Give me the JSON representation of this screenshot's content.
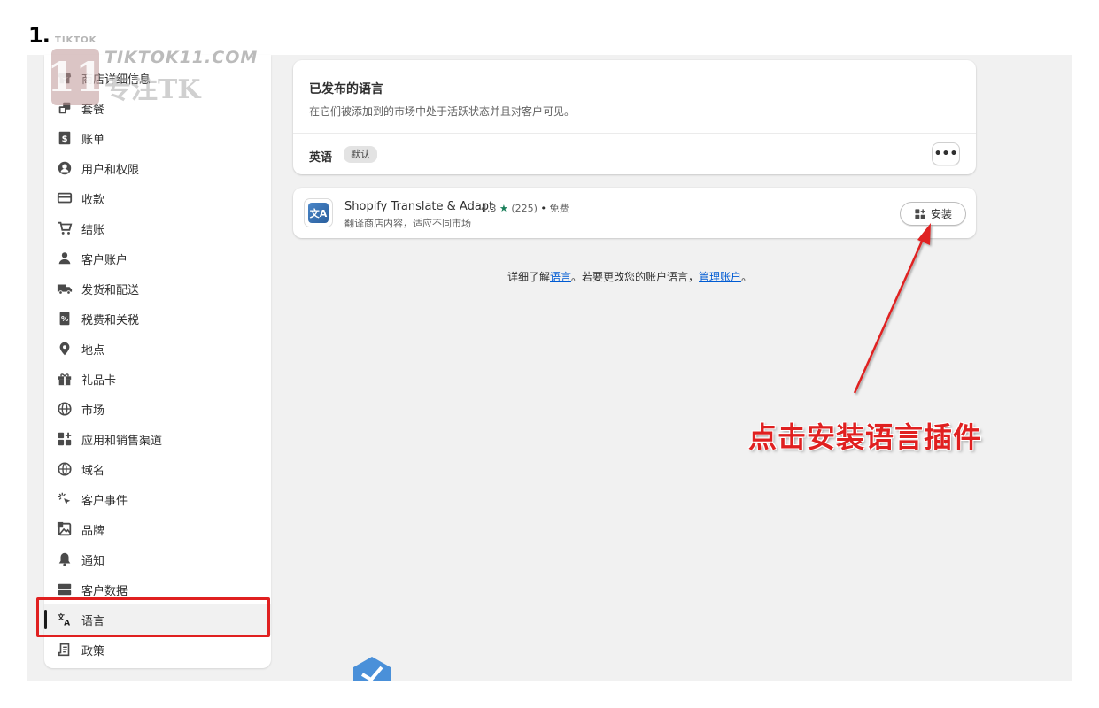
{
  "step_label": "1.",
  "watermark": {
    "small": "TIKTOK",
    "logo": "11",
    "line1": "TIKTOK11.COM",
    "line2": "专注TK"
  },
  "sidebar": {
    "items": [
      {
        "label": "商店详细信息",
        "icon": "store-icon"
      },
      {
        "label": "套餐",
        "icon": "plan-icon"
      },
      {
        "label": "账单",
        "icon": "billing-icon"
      },
      {
        "label": "用户和权限",
        "icon": "user-circle-icon"
      },
      {
        "label": "收款",
        "icon": "payment-card-icon"
      },
      {
        "label": "结账",
        "icon": "cart-icon"
      },
      {
        "label": "客户账户",
        "icon": "person-icon"
      },
      {
        "label": "发货和配送",
        "icon": "truck-icon"
      },
      {
        "label": "税费和关税",
        "icon": "tax-receipt-icon"
      },
      {
        "label": "地点",
        "icon": "location-pin-icon"
      },
      {
        "label": "礼品卡",
        "icon": "gift-icon"
      },
      {
        "label": "市场",
        "icon": "globe-icon"
      },
      {
        "label": "应用和销售渠道",
        "icon": "apps-icon"
      },
      {
        "label": "域名",
        "icon": "domain-globe-icon"
      },
      {
        "label": "客户事件",
        "icon": "cursor-click-icon"
      },
      {
        "label": "品牌",
        "icon": "brand-image-icon"
      },
      {
        "label": "通知",
        "icon": "bell-icon"
      },
      {
        "label": "客户数据",
        "icon": "data-icon"
      },
      {
        "label": "语言",
        "icon": "translate-icon"
      },
      {
        "label": "政策",
        "icon": "policy-scroll-icon"
      }
    ],
    "active_index": 18
  },
  "published_card": {
    "title": "已发布的语言",
    "subtitle": "在它们被添加到的市场中处于活跃状态并且对客户可见。",
    "language": "英语",
    "badge": "默认",
    "more_label": "•••"
  },
  "app_card": {
    "name": "Shopify Translate & Adapt",
    "rating": "4.3",
    "star": "★",
    "reviews": "(225)",
    "separator": "•",
    "price": "免费",
    "description": "翻译商店内容，适应不同市场",
    "install_label": "安装",
    "icon_text": "文A"
  },
  "learn_more": {
    "prefix": "详细了解",
    "link1": "语言",
    "middle": "。若要更改您的账户语言，",
    "link2": "管理账户",
    "suffix": "。"
  },
  "annotation": {
    "text": "点击安装语言插件",
    "color": "#e02020"
  },
  "colors": {
    "background": "#f1f1f1",
    "link": "#005bd3",
    "star": "#1a7f5a",
    "highlight_box": "#e02020"
  }
}
